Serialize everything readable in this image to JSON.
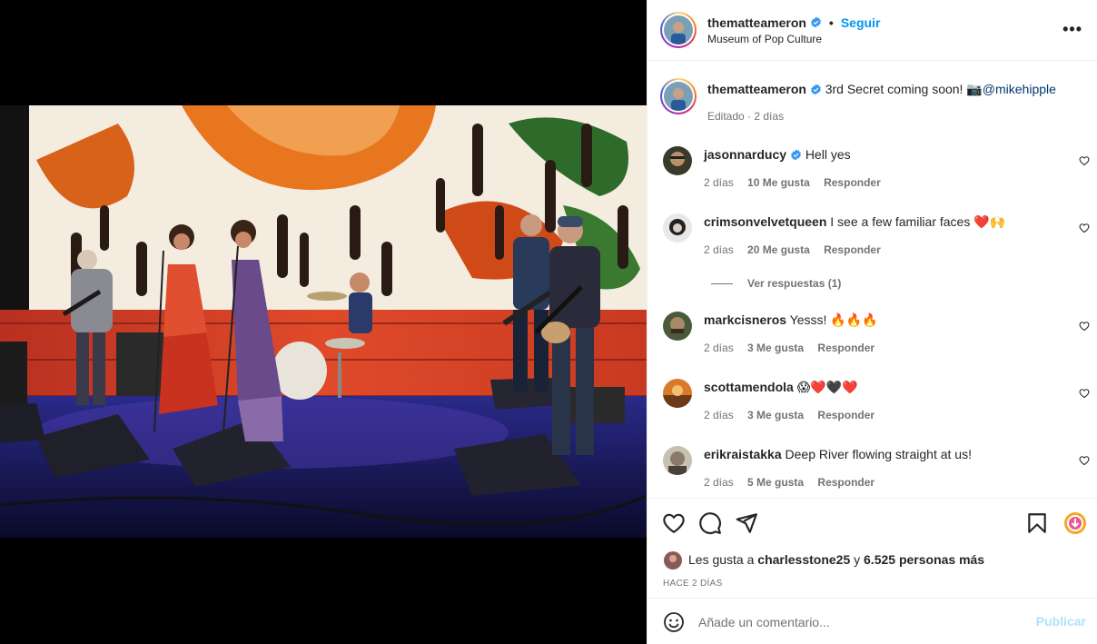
{
  "post": {
    "username": "thematteameron",
    "follow_label": "Seguir",
    "dot": "•",
    "location": "Museum of Pop Culture",
    "more": "•••"
  },
  "caption": {
    "username": "thematteameron",
    "text": "3rd Secret coming soon! 📷",
    "mention": "@mikehipple",
    "edited": "Editado",
    "time": "2 días"
  },
  "comments": [
    {
      "username": "jasonnarducy",
      "verified": true,
      "text": "Hell yes",
      "time": "2 días",
      "likes": "10 Me gusta",
      "reply": "Responder"
    },
    {
      "username": "crimsonvelvetqueen",
      "verified": false,
      "text": "I see a few familiar faces ❤️🙌",
      "time": "2 días",
      "likes": "20 Me gusta",
      "reply": "Responder"
    },
    {
      "username": "markcisneros",
      "verified": false,
      "text": "Yesss! 🔥🔥🔥",
      "time": "2 días",
      "likes": "3 Me gusta",
      "reply": "Responder"
    },
    {
      "username": "scottamendola",
      "verified": false,
      "text": "😱❤️🖤❤️",
      "time": "2 días",
      "likes": "3 Me gusta",
      "reply": "Responder"
    },
    {
      "username": "erikraistakka",
      "verified": false,
      "text": "Deep River flowing straight at us!",
      "time": "2 días",
      "likes": "5 Me gusta",
      "reply": "Responder"
    }
  ],
  "view_replies": "Ver respuestas (1)",
  "likes": {
    "prefix": "Les gusta a",
    "user": "charlesstone25",
    "and": "y",
    "others": "6.525 personas más"
  },
  "posted_ago": "HACE 2 DÍAS",
  "composer": {
    "placeholder": "Añade un comentario...",
    "publish": "Publicar"
  },
  "colors": {
    "link_blue": "#0095f6",
    "verified_blue": "#3897f0",
    "muted_text": "#737373",
    "publish_disabled": "#b2dffc"
  },
  "icons": [
    "heart-icon",
    "comment-icon",
    "share-icon",
    "bookmark-icon",
    "emoji-icon",
    "more-options-icon",
    "verified-badge-icon"
  ]
}
